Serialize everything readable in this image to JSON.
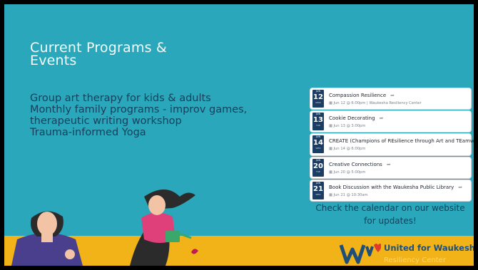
{
  "slide": {
    "title": "Current Programs & Events",
    "bullets": [
      "Group art therapy for kids & adults",
      "Monthly family programs - improv games,",
      "therapeutic writing workshop",
      "Trauma-informed Yoga"
    ],
    "cta": "Check the calendar on our website for updates!"
  },
  "events": [
    {
      "month": "JUN",
      "day": "12",
      "weekday": "MON",
      "title": "Compassion Resilience",
      "meta": "Jun 12 @ 6:00pm | Waukesha Resiliency Center"
    },
    {
      "month": "JUN",
      "day": "13",
      "weekday": "TUE",
      "title": "Cookie Decorating",
      "meta": "Jun 13 @ 3:00pm"
    },
    {
      "month": "JUN",
      "day": "14",
      "weekday": "WED",
      "title": "CREATE (Champions of REsilience through Art and TEamwork)",
      "meta": "Jun 14 @ 6:00pm"
    },
    {
      "month": "JUN",
      "day": "20",
      "weekday": "TUE",
      "title": "Creative Connections",
      "meta": "Jun 20 @ 5:00pm"
    },
    {
      "month": "JUN",
      "day": "21",
      "weekday": "WED",
      "title": "Book Discussion with the Waukesha Public Library",
      "meta": "Jun 21 @ 10:30am"
    }
  ],
  "logo": {
    "name": "United for Waukesha",
    "sub": "Resiliency Center"
  },
  "colors": {
    "background": "#2aa7ba",
    "accent": "#f2b318",
    "text_dark": "#16405e",
    "date_box": "#1b3c63"
  }
}
